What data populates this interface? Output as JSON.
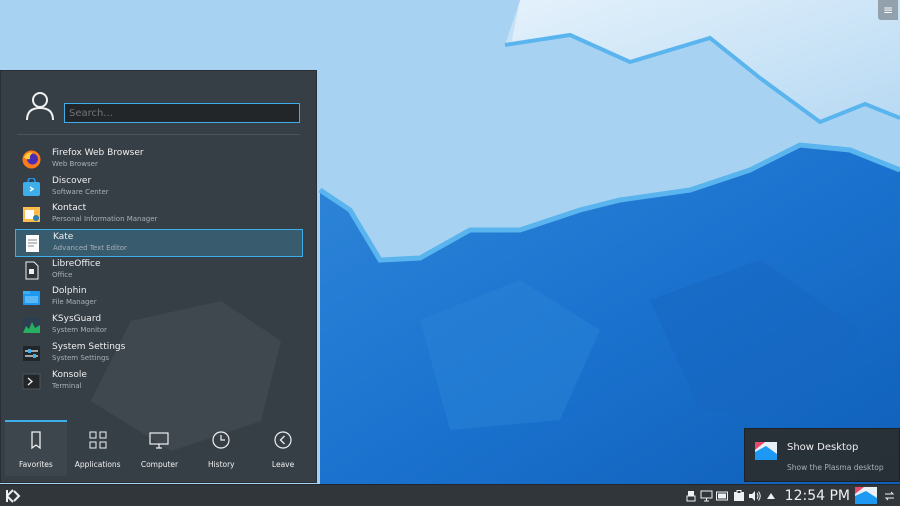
{
  "launcher": {
    "search": {
      "placeholder": "Search..."
    },
    "favorites": [
      {
        "name": "Firefox Web Browser",
        "description": "Web Browser",
        "icon": "firefox-icon"
      },
      {
        "name": "Discover",
        "description": "Software Center",
        "icon": "discover-icon"
      },
      {
        "name": "Kontact",
        "description": "Personal Information Manager",
        "icon": "kontact-icon"
      },
      {
        "name": "Kate",
        "description": "Advanced Text Editor",
        "icon": "kate-icon",
        "selected": true
      },
      {
        "name": "LibreOffice",
        "description": "Office",
        "icon": "libreoffice-icon"
      },
      {
        "name": "Dolphin",
        "description": "File Manager",
        "icon": "dolphin-icon"
      },
      {
        "name": "KSysGuard",
        "description": "System Monitor",
        "icon": "ksysguard-icon"
      },
      {
        "name": "System Settings",
        "description": "System Settings",
        "icon": "settings-icon"
      },
      {
        "name": "Konsole",
        "description": "Terminal",
        "icon": "konsole-icon"
      }
    ],
    "tabs": [
      {
        "label": "Favorites",
        "icon": "bookmark-icon",
        "active": true
      },
      {
        "label": "Applications",
        "icon": "grid-icon"
      },
      {
        "label": "Computer",
        "icon": "monitor-icon"
      },
      {
        "label": "History",
        "icon": "clock-icon"
      },
      {
        "label": "Leave",
        "icon": "back-arrow-icon"
      }
    ]
  },
  "tooltip": {
    "title": "Show Desktop",
    "subtitle": "Show the Plasma desktop"
  },
  "panel": {
    "clock": "12:54 PM"
  },
  "colors": {
    "accent": "#3daee9",
    "panel": "#31363b",
    "menu_bg": "#32383e"
  }
}
